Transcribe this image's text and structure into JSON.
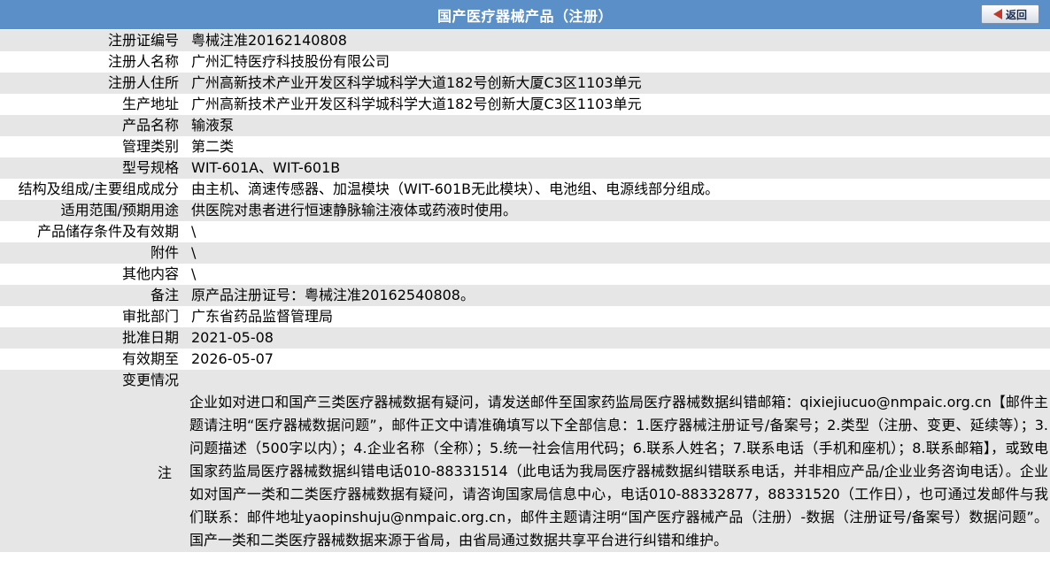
{
  "header": {
    "title": "国产医疗器械产品（注册）",
    "back_label": "返回"
  },
  "rows": [
    {
      "label": "注册证编号",
      "value": "粤械注准20162140808"
    },
    {
      "label": "注册人名称",
      "value": "广州汇特医疗科技股份有限公司"
    },
    {
      "label": "注册人住所",
      "value": "广州高新技术产业开发区科学城科学大道182号创新大厦C3区1103单元"
    },
    {
      "label": "生产地址",
      "value": "广州高新技术产业开发区科学城科学大道182号创新大厦C3区1103单元"
    },
    {
      "label": "产品名称",
      "value": "输液泵"
    },
    {
      "label": "管理类别",
      "value": "第二类"
    },
    {
      "label": "型号规格",
      "value": "WIT-601A、WIT-601B"
    },
    {
      "label": "结构及组成/主要组成成分",
      "value": "由主机、滴速传感器、加温模块（WIT-601B无此模块）、电池组、电源线部分组成。"
    },
    {
      "label": "适用范围/预期用途",
      "value": "供医院对患者进行恒速静脉输注液体或药液时使用。"
    },
    {
      "label": "产品储存条件及有效期",
      "value": "\\"
    },
    {
      "label": "附件",
      "value": "\\"
    },
    {
      "label": "其他内容",
      "value": "\\"
    },
    {
      "label": "备注",
      "value": "原产品注册证号：粤械注准20162540808。"
    },
    {
      "label": "审批部门",
      "value": "广东省药品监督管理局"
    },
    {
      "label": "批准日期",
      "value": "2021-05-08"
    },
    {
      "label": "有效期至",
      "value": "2026-05-07"
    },
    {
      "label": "变更情况",
      "value": ""
    }
  ],
  "note": {
    "label": "注",
    "text": "企业如对进口和国产三类医疗器械数据有疑问，请发送邮件至国家药监局医疗器械数据纠错邮箱：qixiejiucuo@nmpaic.org.cn【邮件主题请注明“医疗器械数据问题”，邮件正文中请准确填写以下全部信息：1.医疗器械注册证号/备案号；2.类型（注册、变更、延续等）；3.问题描述（500字以内）；4.企业名称（全称）；5.统一社会信用代码；6.联系人姓名；7.联系电话（手机和座机）；8.联系邮箱】，或致电国家药监局医疗器械数据纠错电话010-88331514（此电话为我局医疗器械数据纠错联系电话，并非相应产品/企业业务咨询电话）。企业如对国产一类和二类医疗器械数据有疑问，请咨询国家局信息中心，电话010-88332877，88331520（工作日），也可通过发邮件与我们联系：邮件地址yaopinshuju@nmpaic.org.cn，邮件主题请注明“国产医疗器械产品（注册）-数据（注册证号/备案号）数据问题”。国产一类和二类医疗器械数据来源于省局，由省局通过数据共享平台进行纠错和维护。"
  },
  "colors": {
    "header_bg": "#5b8fc7",
    "row_shade": "#e6e6e6",
    "back_arrow": "#c0392b"
  }
}
